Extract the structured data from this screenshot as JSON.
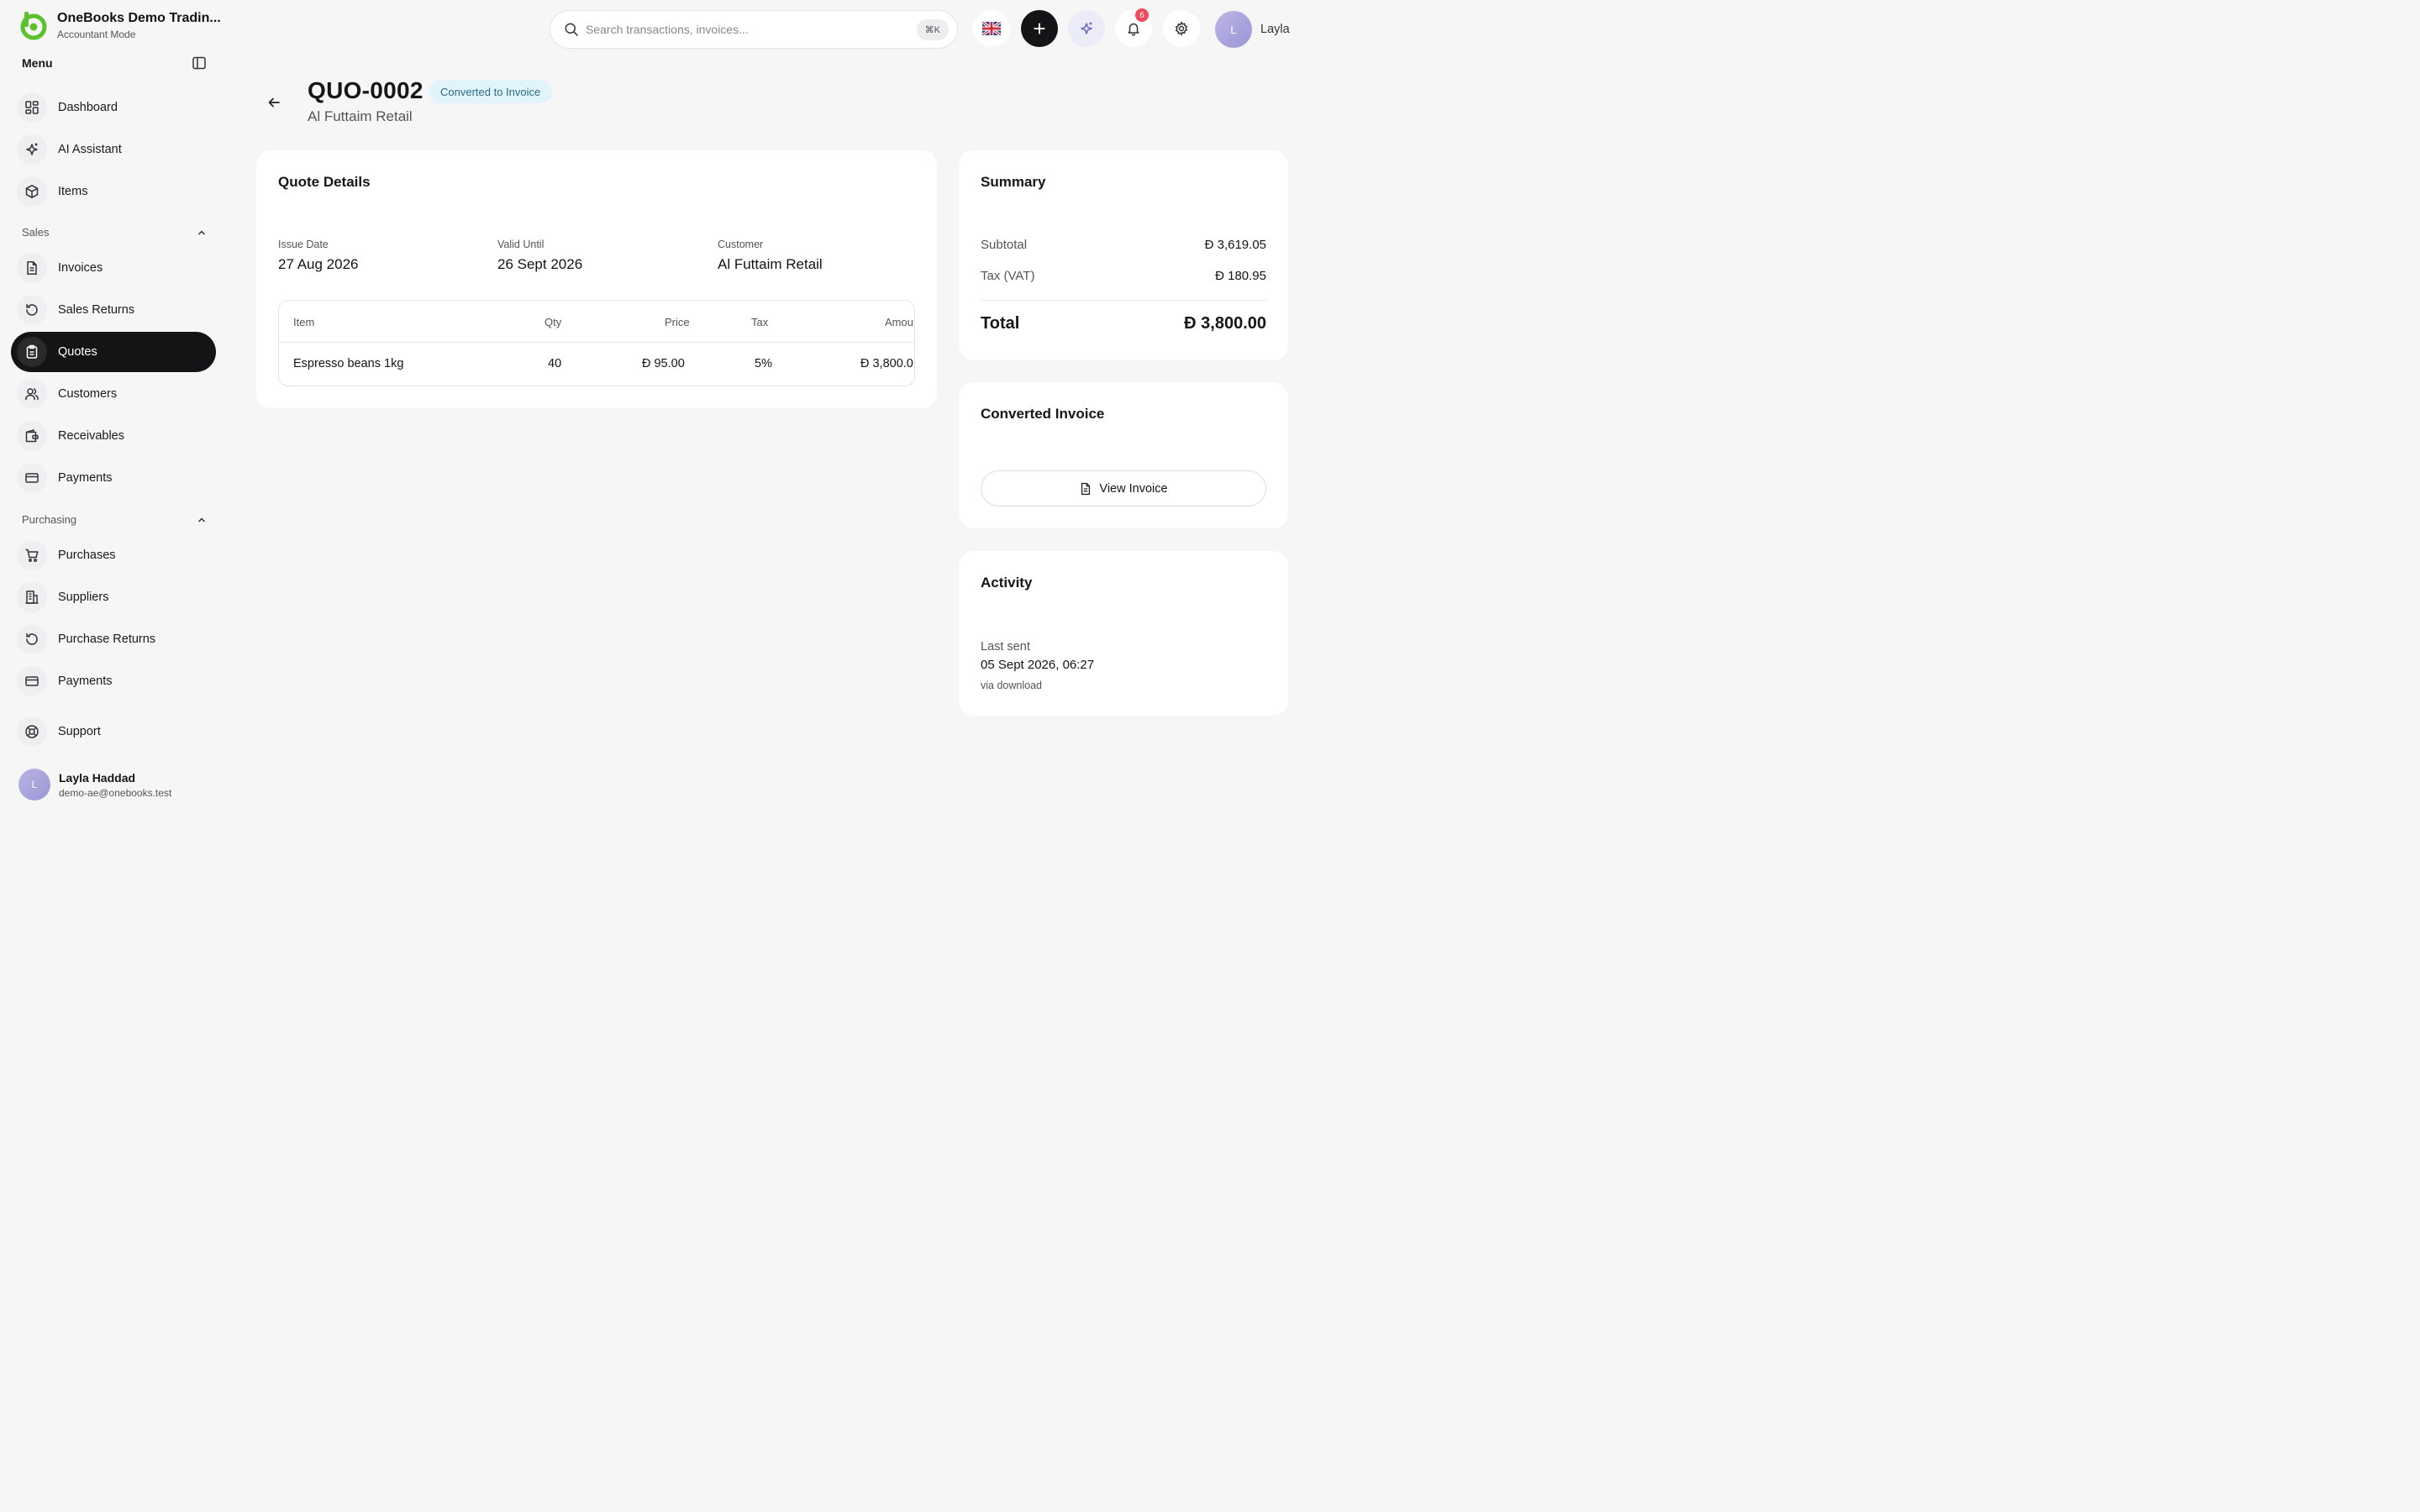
{
  "brand": {
    "name": "OneBooks Demo Tradin...",
    "mode": "Accountant Mode"
  },
  "menu": {
    "title": "Menu"
  },
  "nav_top": [
    {
      "label": "Dashboard",
      "icon": "dashboard-icon"
    },
    {
      "label": "AI Assistant",
      "icon": "sparkle-icon"
    },
    {
      "label": "Items",
      "icon": "box-icon"
    }
  ],
  "sales": {
    "title": "Sales",
    "items": [
      {
        "label": "Invoices",
        "icon": "document-icon"
      },
      {
        "label": "Sales Returns",
        "icon": "return-icon"
      },
      {
        "label": "Quotes",
        "icon": "clipboard-icon",
        "active": true
      },
      {
        "label": "Customers",
        "icon": "users-icon"
      },
      {
        "label": "Receivables",
        "icon": "wallet-icon"
      },
      {
        "label": "Payments",
        "icon": "card-icon"
      }
    ]
  },
  "purchasing": {
    "title": "Purchasing",
    "items": [
      {
        "label": "Purchases",
        "icon": "cart-icon"
      },
      {
        "label": "Suppliers",
        "icon": "building-icon"
      },
      {
        "label": "Purchase Returns",
        "icon": "return-icon"
      },
      {
        "label": "Payments",
        "icon": "card-icon"
      }
    ]
  },
  "support": {
    "label": "Support",
    "icon": "lifebuoy-icon"
  },
  "user": {
    "initial": "L",
    "name": "Layla Haddad",
    "email": "demo-ae@onebooks.test",
    "short_name": "Layla"
  },
  "search": {
    "placeholder": "Search transactions, invoices...",
    "shortcut": "⌘K"
  },
  "notifications": {
    "count": "6"
  },
  "header": {
    "doc_number": "QUO-0002",
    "status": "Converted to Invoice",
    "customer": "Al Futtaim Retail"
  },
  "quote_details": {
    "title": "Quote Details",
    "issue_date_label": "Issue Date",
    "issue_date": "27 Aug 2026",
    "valid_until_label": "Valid Until",
    "valid_until": "26 Sept 2026",
    "customer_label": "Customer",
    "customer": "Al Futtaim Retail",
    "columns": [
      "Item",
      "Qty",
      "Price",
      "Tax",
      "Amou"
    ],
    "rows": [
      {
        "item": "Espresso beans 1kg",
        "qty": "40",
        "price": "95.00",
        "tax": "5%",
        "amount": "3,800.0"
      }
    ]
  },
  "currency_symbol": "Đ",
  "summary": {
    "title": "Summary",
    "subtotal_label": "Subtotal",
    "subtotal": "3,619.05",
    "tax_label": "Tax (VAT)",
    "tax": "180.95",
    "total_label": "Total",
    "total": "3,800.00"
  },
  "converted": {
    "title": "Converted Invoice",
    "button": "View Invoice"
  },
  "activity": {
    "title": "Activity",
    "label": "Last sent",
    "value": "05 Sept 2026, 06:27",
    "via": "via download"
  }
}
